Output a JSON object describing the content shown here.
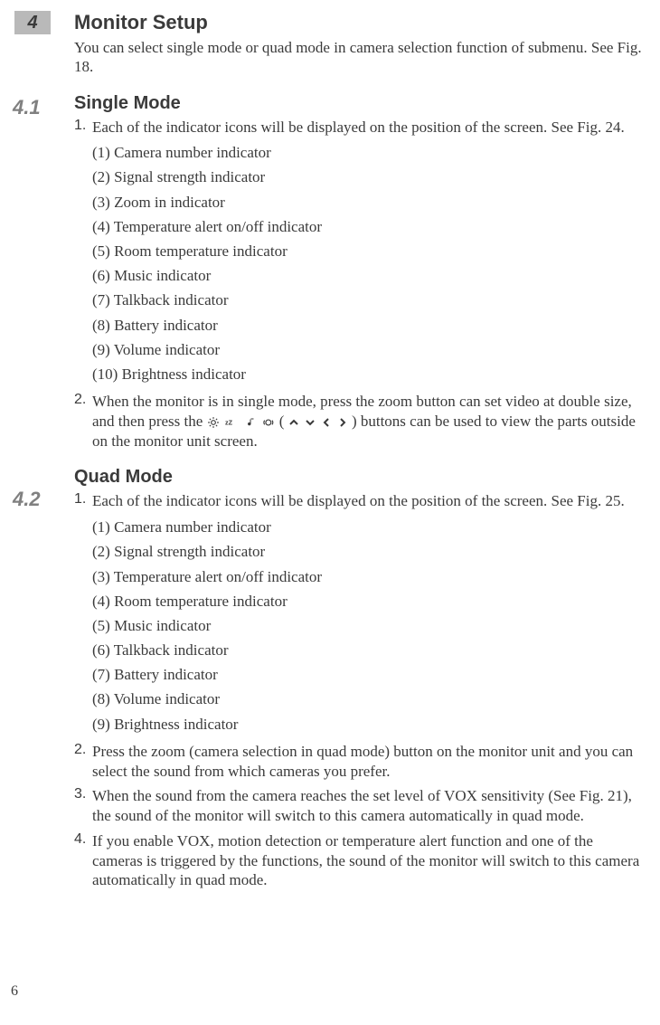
{
  "section4": {
    "badge": "4",
    "title": "Monitor Setup",
    "intro": "You can select single mode or quad mode in camera selection function of submenu.  See Fig. 18."
  },
  "section41": {
    "badge": "4.1",
    "title": "Single Mode",
    "item1": {
      "num": "1.",
      "text": "Each of the indicator icons will be displayed on the position of the screen. See Fig. 24.",
      "sub": [
        "(1) Camera number indicator",
        "(2) Signal strength indicator",
        "(3) Zoom in indicator",
        "(4) Temperature alert on/off indicator",
        "(5) Room temperature indicator",
        "(6) Music indicator",
        "(7) Talkback indicator",
        "(8) Battery indicator",
        "(9) Volume indicator",
        "(10) Brightness indicator"
      ]
    },
    "item2": {
      "num": "2.",
      "pre": "When the monitor is in single mode, press the zoom button can set video at double size, and then press the ",
      "mid": " ( ",
      "post": " ) buttons can be used to view the parts outside on the monitor unit screen."
    }
  },
  "section42": {
    "badge": "4.2",
    "title": "Quad Mode",
    "item1": {
      "num": "1.",
      "text": "Each of the indicator icons will be displayed on the position of the screen. See Fig. 25.",
      "sub": [
        "(1) Camera number indicator",
        "(2) Signal strength indicator",
        "(3) Temperature alert on/off indicator",
        "(4) Room temperature indicator",
        "(5) Music indicator",
        "(6) Talkback indicator",
        "(7) Battery indicator",
        "(8) Volume indicator",
        "(9) Brightness indicator"
      ]
    },
    "item2": {
      "num": "2.",
      "text": "Press the zoom (camera selection in quad mode) button on the monitor unit and you can select the sound from which cameras you prefer."
    },
    "item3": {
      "num": "3.",
      "text": "When the sound from the camera reaches the set level of  VOX sensitivity (See Fig. 21), the sound of the monitor will switch to this camera automatically in quad mode."
    },
    "item4": {
      "num": "4.",
      "text": "If you enable VOX, motion detection or temperature alert function and one of the cameras is triggered by the functions, the sound of the monitor will switch to this camera automatically in quad mode."
    }
  },
  "pageNumber": "6"
}
